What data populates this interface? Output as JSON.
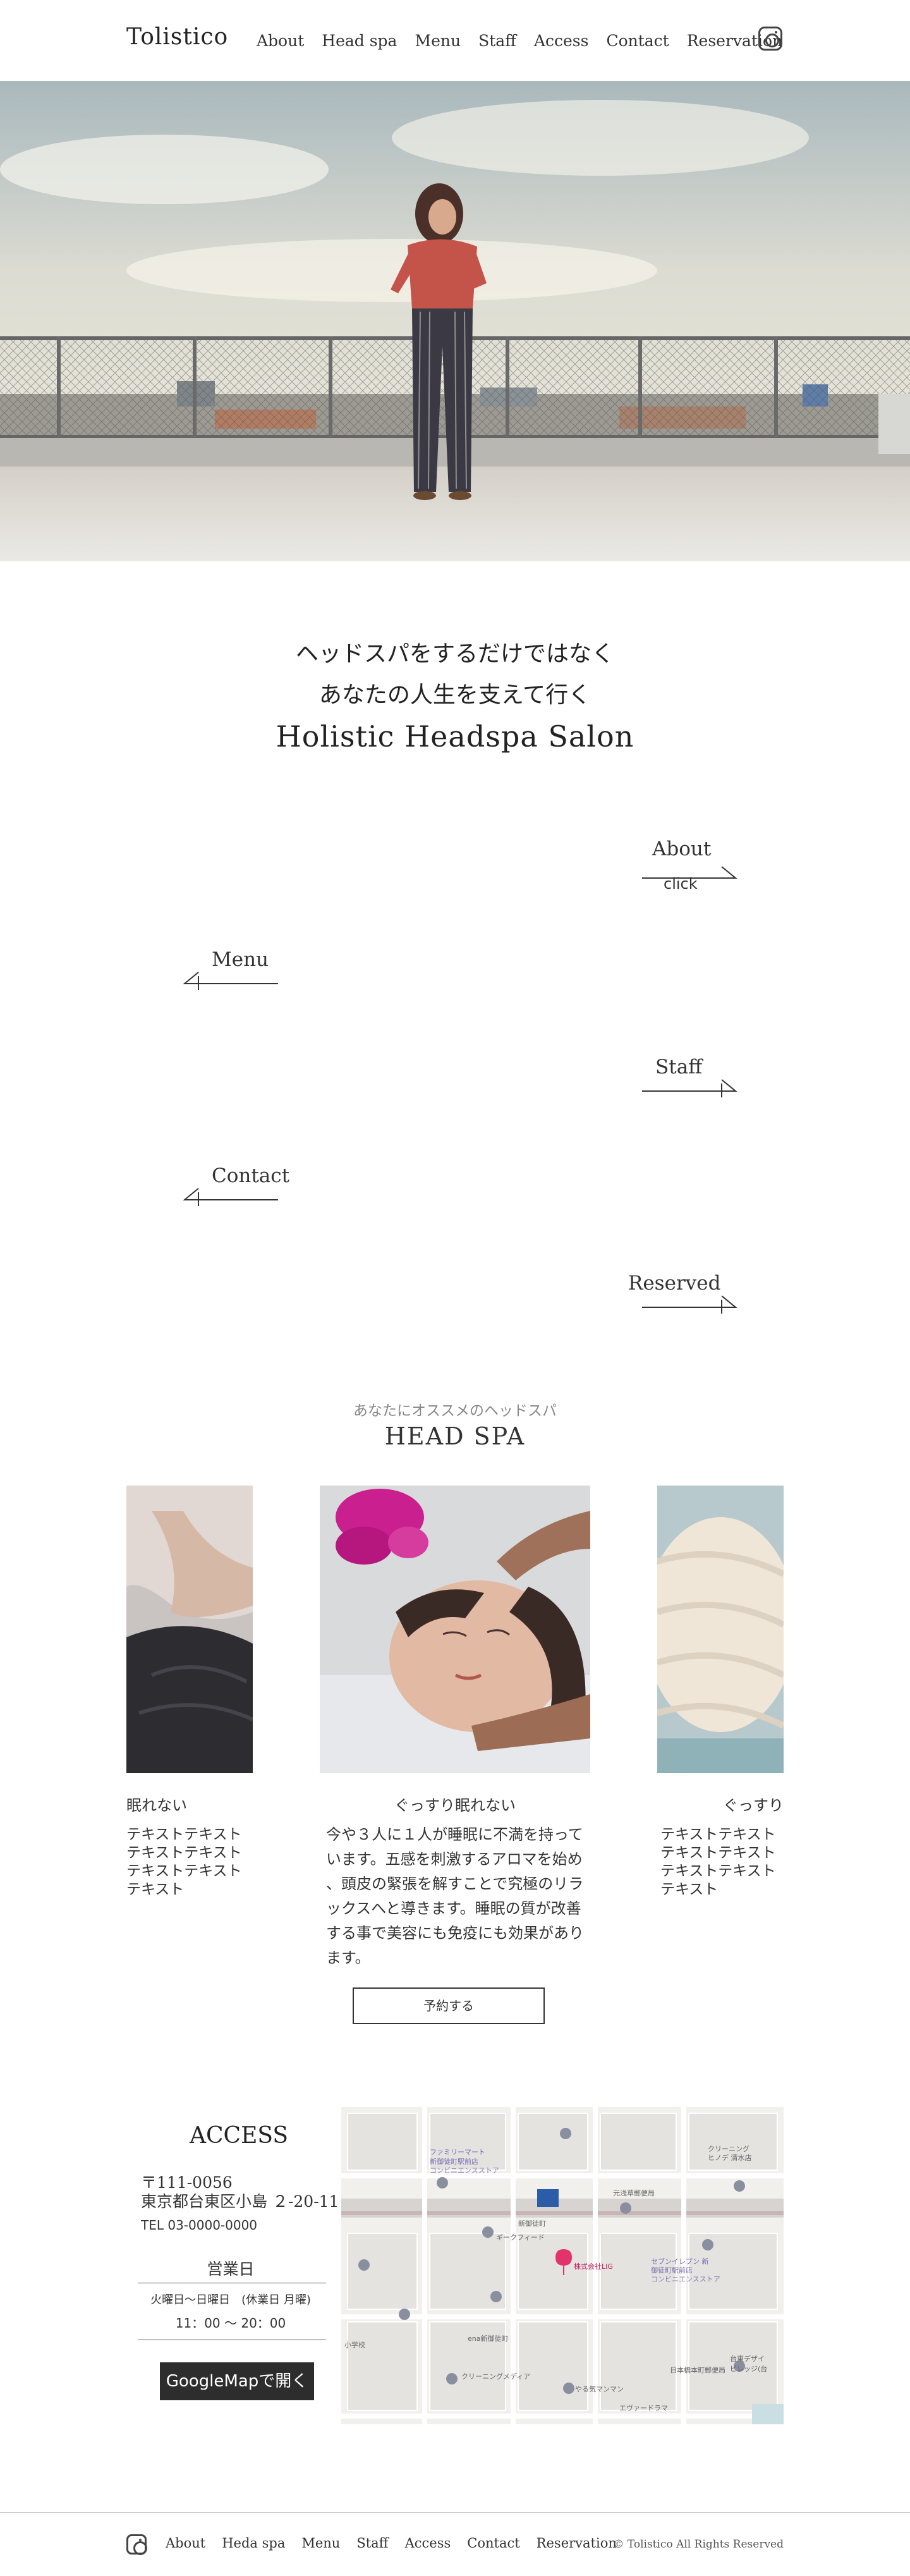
{
  "header": {
    "logo": "Tolistico",
    "nav": [
      "About",
      "Head spa",
      "Menu",
      "Staff",
      "Access",
      "Contact",
      "Reservation"
    ],
    "instagram_icon": "instagram-icon"
  },
  "hero": {
    "image": "woman-on-rooftop-photo"
  },
  "catch": {
    "line1": "ヘッドスパをするだけではなく",
    "line2": "あなたの人生を支えて行く",
    "line3": "Holistic Headspa Salon"
  },
  "sections": {
    "about": {
      "label": "About",
      "sub": "click"
    },
    "menu": {
      "label": "Menu"
    },
    "staff": {
      "label": "Staff"
    },
    "contact": {
      "label": "Contact"
    },
    "reserved": {
      "label": "Reserved"
    }
  },
  "headspa": {
    "subtitle": "あなたにオススメのヘッドスパ",
    "title": "HEAD SPA",
    "cards": [
      {
        "title": "眠れない",
        "text": "テキストテキスト\nテキストテキスト\nテキストテキスト\nテキスト"
      },
      {
        "title": "ぐっすり眠れない",
        "text": "今や３人に１人が睡眠に不満を持って\nいます。五感を刺激するアロマを始め\n、頭皮の緊張を解すことで究極のリラ\nックスへと導きます。睡眠の質が改善\nする事で美容にも免疫にも効果があり\nます。"
      },
      {
        "title": "ぐっすり",
        "text": "テキストテキスト\nテキストテキスト\nテキストテキスト\nテキスト"
      }
    ],
    "reserve_button": "予約する"
  },
  "access": {
    "title": "ACCESS",
    "postal": "〒111-0056",
    "address": "東京都台東区小島 ２-20-11",
    "tel": "TEL 03-0000-0000",
    "hours_title": "営業日",
    "days": "火曜日〜日曜日　(休業日 月曜)",
    "hours": "11：00 〜 20：00",
    "map_button": "GoogleMapで開く",
    "map": {
      "labels": [
        "ファミリーマート",
        "新御徒町駅前店",
        "コンビニエンスストア",
        "クリーニング",
        "ヒノデ 清水店",
        "元浅草郵便局",
        "新御徒町",
        "ギークフィード",
        "株式会社LIG",
        "セブンイレブン 新",
        "御徒町駅前店",
        "コンビニエンスストア",
        "ena新御徒町",
        "クリーニングメディア",
        "やる気マンマン",
        "小学校",
        "台東デザイ",
        "ビレッジ(台",
        "日本橋本町郵便局",
        "エヴァードラマ"
      ],
      "pin_color": "#e2336b"
    }
  },
  "footer": {
    "nav": [
      "About",
      "Heda spa",
      "Menu",
      "Staff",
      "Access",
      "Contact",
      "Reservation"
    ],
    "copyright": "© Tolistico All Rights Reserved"
  }
}
